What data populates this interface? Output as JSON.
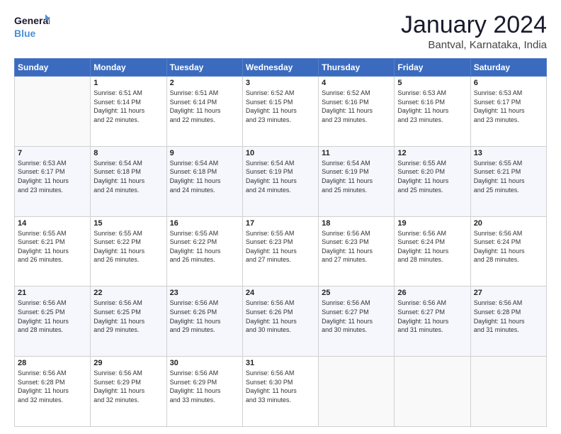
{
  "logo": {
    "line1": "General",
    "line2": "Blue"
  },
  "title": "January 2024",
  "subtitle": "Bantval, Karnataka, India",
  "header_days": [
    "Sunday",
    "Monday",
    "Tuesday",
    "Wednesday",
    "Thursday",
    "Friday",
    "Saturday"
  ],
  "weeks": [
    [
      {
        "day": "",
        "info": ""
      },
      {
        "day": "1",
        "info": "Sunrise: 6:51 AM\nSunset: 6:14 PM\nDaylight: 11 hours\nand 22 minutes."
      },
      {
        "day": "2",
        "info": "Sunrise: 6:51 AM\nSunset: 6:14 PM\nDaylight: 11 hours\nand 22 minutes."
      },
      {
        "day": "3",
        "info": "Sunrise: 6:52 AM\nSunset: 6:15 PM\nDaylight: 11 hours\nand 23 minutes."
      },
      {
        "day": "4",
        "info": "Sunrise: 6:52 AM\nSunset: 6:16 PM\nDaylight: 11 hours\nand 23 minutes."
      },
      {
        "day": "5",
        "info": "Sunrise: 6:53 AM\nSunset: 6:16 PM\nDaylight: 11 hours\nand 23 minutes."
      },
      {
        "day": "6",
        "info": "Sunrise: 6:53 AM\nSunset: 6:17 PM\nDaylight: 11 hours\nand 23 minutes."
      }
    ],
    [
      {
        "day": "7",
        "info": "Sunrise: 6:53 AM\nSunset: 6:17 PM\nDaylight: 11 hours\nand 23 minutes."
      },
      {
        "day": "8",
        "info": "Sunrise: 6:54 AM\nSunset: 6:18 PM\nDaylight: 11 hours\nand 24 minutes."
      },
      {
        "day": "9",
        "info": "Sunrise: 6:54 AM\nSunset: 6:18 PM\nDaylight: 11 hours\nand 24 minutes."
      },
      {
        "day": "10",
        "info": "Sunrise: 6:54 AM\nSunset: 6:19 PM\nDaylight: 11 hours\nand 24 minutes."
      },
      {
        "day": "11",
        "info": "Sunrise: 6:54 AM\nSunset: 6:19 PM\nDaylight: 11 hours\nand 25 minutes."
      },
      {
        "day": "12",
        "info": "Sunrise: 6:55 AM\nSunset: 6:20 PM\nDaylight: 11 hours\nand 25 minutes."
      },
      {
        "day": "13",
        "info": "Sunrise: 6:55 AM\nSunset: 6:21 PM\nDaylight: 11 hours\nand 25 minutes."
      }
    ],
    [
      {
        "day": "14",
        "info": "Sunrise: 6:55 AM\nSunset: 6:21 PM\nDaylight: 11 hours\nand 26 minutes."
      },
      {
        "day": "15",
        "info": "Sunrise: 6:55 AM\nSunset: 6:22 PM\nDaylight: 11 hours\nand 26 minutes."
      },
      {
        "day": "16",
        "info": "Sunrise: 6:55 AM\nSunset: 6:22 PM\nDaylight: 11 hours\nand 26 minutes."
      },
      {
        "day": "17",
        "info": "Sunrise: 6:55 AM\nSunset: 6:23 PM\nDaylight: 11 hours\nand 27 minutes."
      },
      {
        "day": "18",
        "info": "Sunrise: 6:56 AM\nSunset: 6:23 PM\nDaylight: 11 hours\nand 27 minutes."
      },
      {
        "day": "19",
        "info": "Sunrise: 6:56 AM\nSunset: 6:24 PM\nDaylight: 11 hours\nand 28 minutes."
      },
      {
        "day": "20",
        "info": "Sunrise: 6:56 AM\nSunset: 6:24 PM\nDaylight: 11 hours\nand 28 minutes."
      }
    ],
    [
      {
        "day": "21",
        "info": "Sunrise: 6:56 AM\nSunset: 6:25 PM\nDaylight: 11 hours\nand 28 minutes."
      },
      {
        "day": "22",
        "info": "Sunrise: 6:56 AM\nSunset: 6:25 PM\nDaylight: 11 hours\nand 29 minutes."
      },
      {
        "day": "23",
        "info": "Sunrise: 6:56 AM\nSunset: 6:26 PM\nDaylight: 11 hours\nand 29 minutes."
      },
      {
        "day": "24",
        "info": "Sunrise: 6:56 AM\nSunset: 6:26 PM\nDaylight: 11 hours\nand 30 minutes."
      },
      {
        "day": "25",
        "info": "Sunrise: 6:56 AM\nSunset: 6:27 PM\nDaylight: 11 hours\nand 30 minutes."
      },
      {
        "day": "26",
        "info": "Sunrise: 6:56 AM\nSunset: 6:27 PM\nDaylight: 11 hours\nand 31 minutes."
      },
      {
        "day": "27",
        "info": "Sunrise: 6:56 AM\nSunset: 6:28 PM\nDaylight: 11 hours\nand 31 minutes."
      }
    ],
    [
      {
        "day": "28",
        "info": "Sunrise: 6:56 AM\nSunset: 6:28 PM\nDaylight: 11 hours\nand 32 minutes."
      },
      {
        "day": "29",
        "info": "Sunrise: 6:56 AM\nSunset: 6:29 PM\nDaylight: 11 hours\nand 32 minutes."
      },
      {
        "day": "30",
        "info": "Sunrise: 6:56 AM\nSunset: 6:29 PM\nDaylight: 11 hours\nand 33 minutes."
      },
      {
        "day": "31",
        "info": "Sunrise: 6:56 AM\nSunset: 6:30 PM\nDaylight: 11 hours\nand 33 minutes."
      },
      {
        "day": "",
        "info": ""
      },
      {
        "day": "",
        "info": ""
      },
      {
        "day": "",
        "info": ""
      }
    ]
  ]
}
